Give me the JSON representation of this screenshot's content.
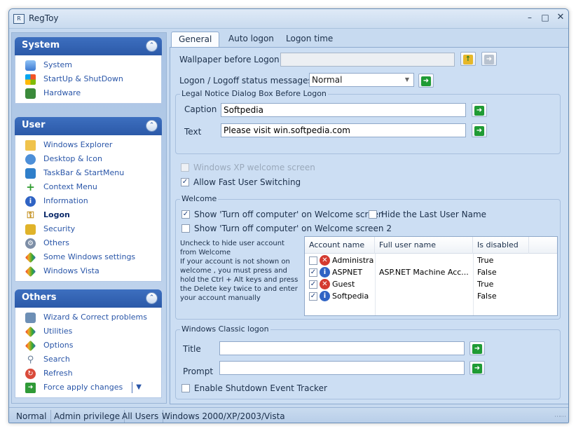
{
  "window": {
    "title": "RegToy"
  },
  "sidebar": {
    "system": {
      "title": "System",
      "items": [
        {
          "label": "System",
          "icon": "monitor-icon"
        },
        {
          "label": "StartUp & ShutDown",
          "icon": "windows-logo-icon"
        },
        {
          "label": "Hardware",
          "icon": "circuit-board-icon"
        }
      ]
    },
    "user": {
      "title": "User",
      "items": [
        {
          "label": "Windows Explorer",
          "icon": "folder-icon"
        },
        {
          "label": "Desktop & Icon",
          "icon": "desktop-icon"
        },
        {
          "label": "TaskBar & StartMenu",
          "icon": "taskbar-icon"
        },
        {
          "label": "Context Menu",
          "icon": "plus-icon"
        },
        {
          "label": "Information",
          "icon": "info-icon"
        },
        {
          "label": "Logon",
          "icon": "key-icon"
        },
        {
          "label": "Security",
          "icon": "lock-icon"
        },
        {
          "label": "Others",
          "icon": "gear-icon"
        },
        {
          "label": "Some Windows settings",
          "icon": "pen-icon"
        },
        {
          "label": "Windows Vista",
          "icon": "pen-icon"
        }
      ]
    },
    "others": {
      "title": "Others",
      "items": [
        {
          "label": "Wizard & Correct problems",
          "icon": "wizard-icon"
        },
        {
          "label": "Utilities",
          "icon": "pen-icon"
        },
        {
          "label": "Options",
          "icon": "pen-icon"
        },
        {
          "label": "Search",
          "icon": "search-icon"
        },
        {
          "label": "Refresh",
          "icon": "refresh-icon"
        },
        {
          "label": "Force apply changes",
          "icon": "arrow-right-icon"
        }
      ]
    }
  },
  "tabs": [
    "General",
    "Auto logon",
    "Logon time"
  ],
  "general": {
    "wallpaper_label": "Wallpaper before Logon",
    "wallpaper_value": "",
    "status_label": "Logon / Logoff status messages",
    "status_value": "Normal",
    "legal": {
      "title": "Legal Notice Dialog Box Before Logon",
      "caption_label": "Caption",
      "caption_value": "Softpedia",
      "text_label": "Text",
      "text_value": "Please visit win.softpedia.com"
    },
    "xp_welcome": "Windows XP welcome screen",
    "fast_switching": "Allow Fast User Switching",
    "welcome": {
      "title": "Welcome",
      "turn_off_1": "Show 'Turn off computer' on Welcome screen",
      "hide_last_user": "Hide the Last User Name",
      "turn_off_2": "Show 'Turn off computer' on Welcome screen 2",
      "help_1": "Uncheck to hide user account from Welcome",
      "help_2": "If your account is not shown on welcome , you must press and hold the Ctrl + Alt keys and press the Delete key twice to and enter your account manually",
      "columns": [
        "Account name",
        "Full user name",
        "Is disabled"
      ],
      "accounts": [
        {
          "name": "Administra...",
          "full": "",
          "disabled": "True",
          "checked": false,
          "icon": "x"
        },
        {
          "name": "ASPNET",
          "full": "ASP.NET Machine Acc...",
          "disabled": "False",
          "checked": true,
          "icon": "i"
        },
        {
          "name": "Guest",
          "full": "",
          "disabled": "True",
          "checked": true,
          "icon": "x"
        },
        {
          "name": "Softpedia",
          "full": "",
          "disabled": "False",
          "checked": true,
          "icon": "i"
        }
      ]
    },
    "classic": {
      "title": "Windows Classic logon",
      "title_label": "Title",
      "title_value": "",
      "prompt_label": "Prompt",
      "prompt_value": "",
      "shutdown_tracker": "Enable Shutdown Event Tracker"
    }
  },
  "statusbar": [
    "Normal",
    "Admin privilege",
    "All Users",
    "Windows 2000/XP/2003/Vista"
  ]
}
